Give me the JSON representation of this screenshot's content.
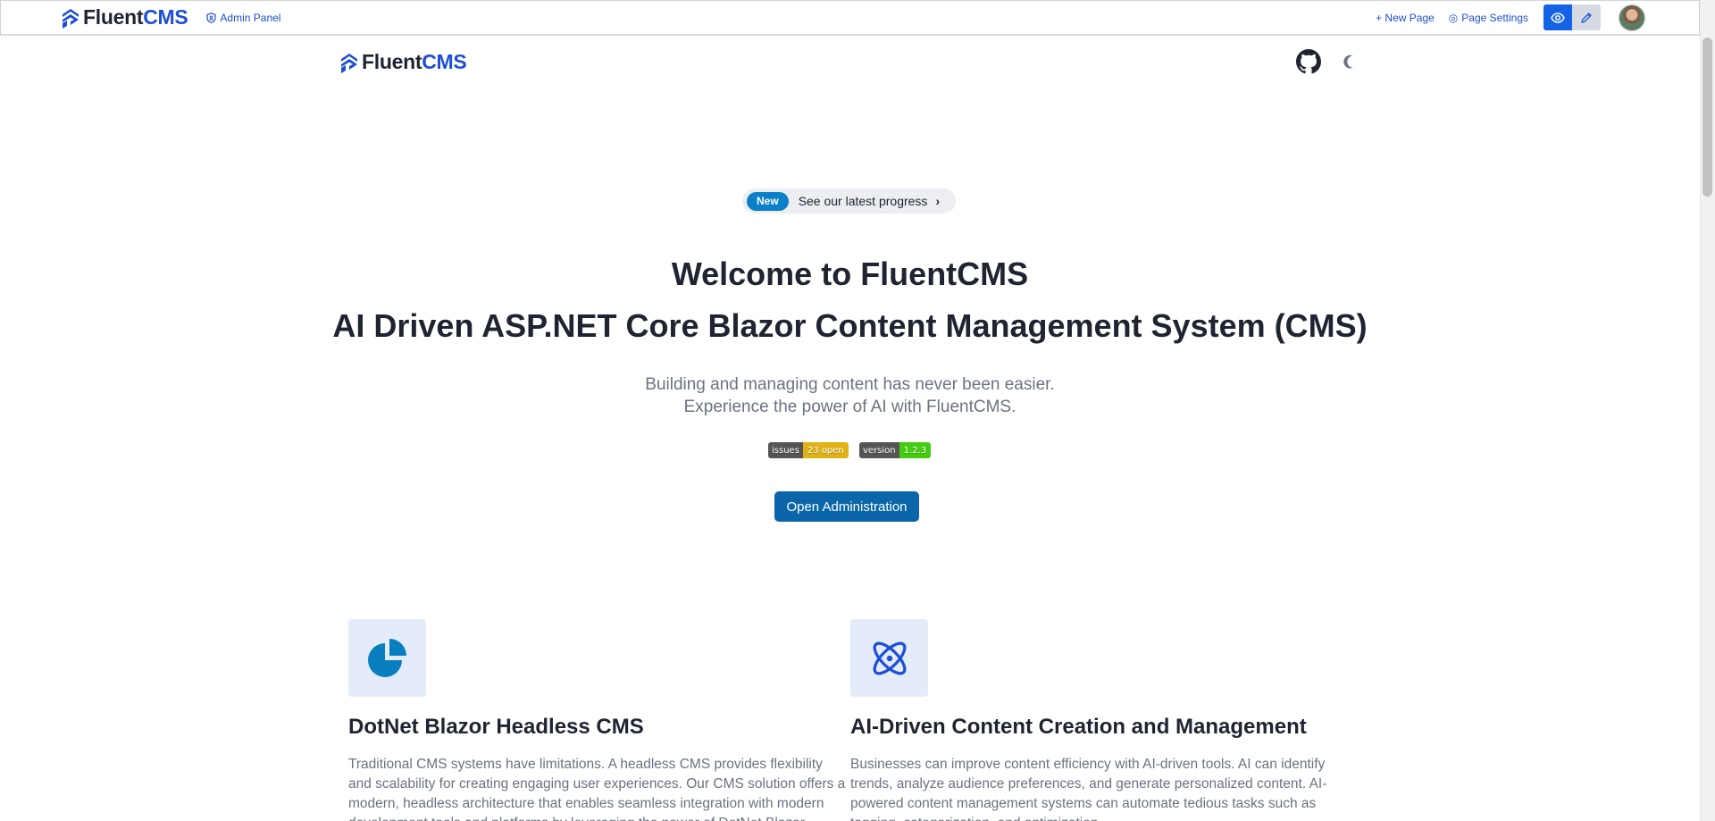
{
  "admin_bar": {
    "brand_fluent": "Fluent",
    "brand_cms": "CMS",
    "admin_panel_label": "Admin Panel",
    "new_page_label": "+ New Page",
    "page_settings_label": "Page Settings",
    "page_settings_icon": "◎"
  },
  "site_header": {
    "brand_fluent": "Fluent",
    "brand_cms": "CMS"
  },
  "hero": {
    "pill_tag": "New",
    "pill_text": "See our latest progress",
    "pill_chevron": "›",
    "title_line1": "Welcome to FluentCMS",
    "title_line2": "AI Driven ASP.NET Core Blazor Content Management System (CMS)",
    "subtitle_line1": "Building and managing content has never been easier.",
    "subtitle_line2": "Experience the power of AI with FluentCMS.",
    "badge_issues_key": "issues",
    "badge_issues_value": "23 open",
    "badge_version_key": "version",
    "badge_version_value": "1.2.3",
    "cta_label": "Open Administration"
  },
  "features": [
    {
      "title": "DotNet Blazor Headless CMS",
      "body": "Traditional CMS systems have limitations. A headless CMS provides flexibility and scalability for creating engaging user experiences. Our CMS solution offers a modern, headless architecture that enables seamless integration with modern development tools and platforms by leveraging the power of DotNet Blazor."
    },
    {
      "title": "AI-Driven Content Creation and Management",
      "body": "Businesses can improve content efficiency with AI-driven tools. AI can identify trends, analyze audience preferences, and generate personalized content. AI-powered content management systems can automate tedious tasks such as tagging, categorization, and optimization."
    }
  ],
  "colors": {
    "accent_blue": "#1d4ed8",
    "cta_blue": "#0a66a8",
    "pill_blue": "#0a80c9",
    "feature_icon_blue": "#0a7fc0",
    "feature_icon_bg": "#e3ecf8"
  }
}
